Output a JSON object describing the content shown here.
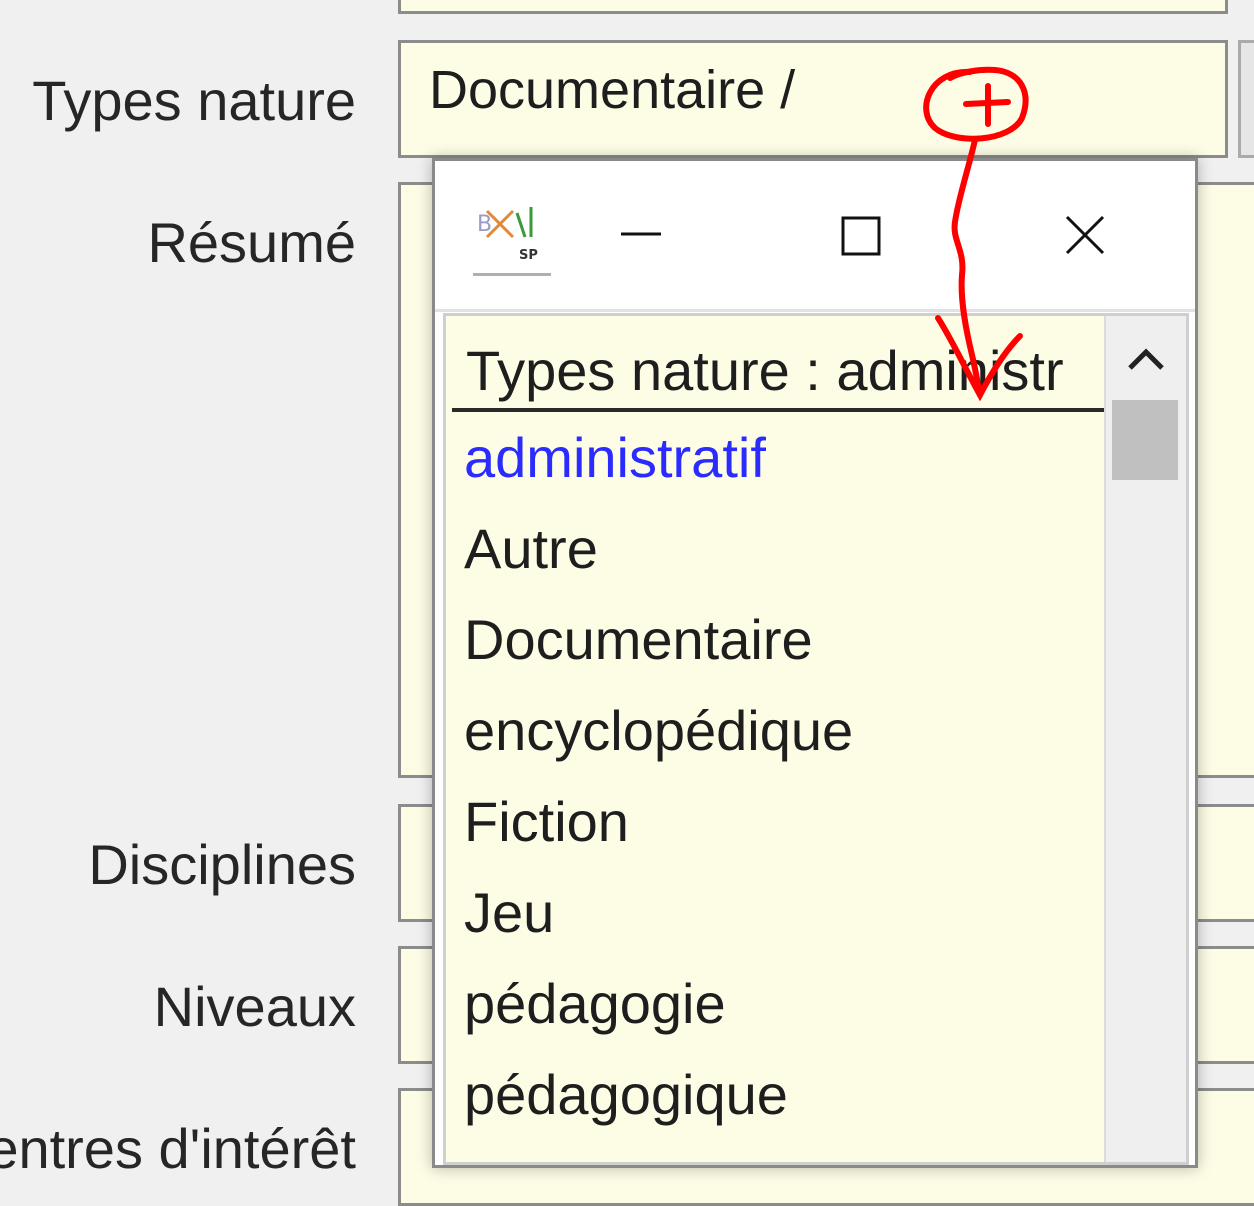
{
  "form": {
    "labels": {
      "types_nature": "Types nature",
      "resume": "Résumé",
      "disciplines": "Disciplines",
      "niveaux": "Niveaux",
      "centres": "entres d'intérêt"
    },
    "types_nature_value": "Documentaire /"
  },
  "popup": {
    "header": "Types nature  : administr",
    "items": [
      {
        "label": "administratif",
        "selected": true
      },
      {
        "label": "Autre"
      },
      {
        "label": "Documentaire"
      },
      {
        "label": "encyclopédique"
      },
      {
        "label": "Fiction"
      },
      {
        "label": "Jeu"
      },
      {
        "label": "pédagogie"
      },
      {
        "label": "pédagogique"
      }
    ]
  },
  "colors": {
    "field_bg": "#fdfde6",
    "selected_text": "#2b2bff",
    "annotation": "#ff0000"
  },
  "icons": {
    "logo": "app-logo-icon",
    "minimize": "minimize-icon",
    "maximize": "maximize-icon",
    "close": "close-icon",
    "scroll_up": "chevron-up-icon"
  }
}
